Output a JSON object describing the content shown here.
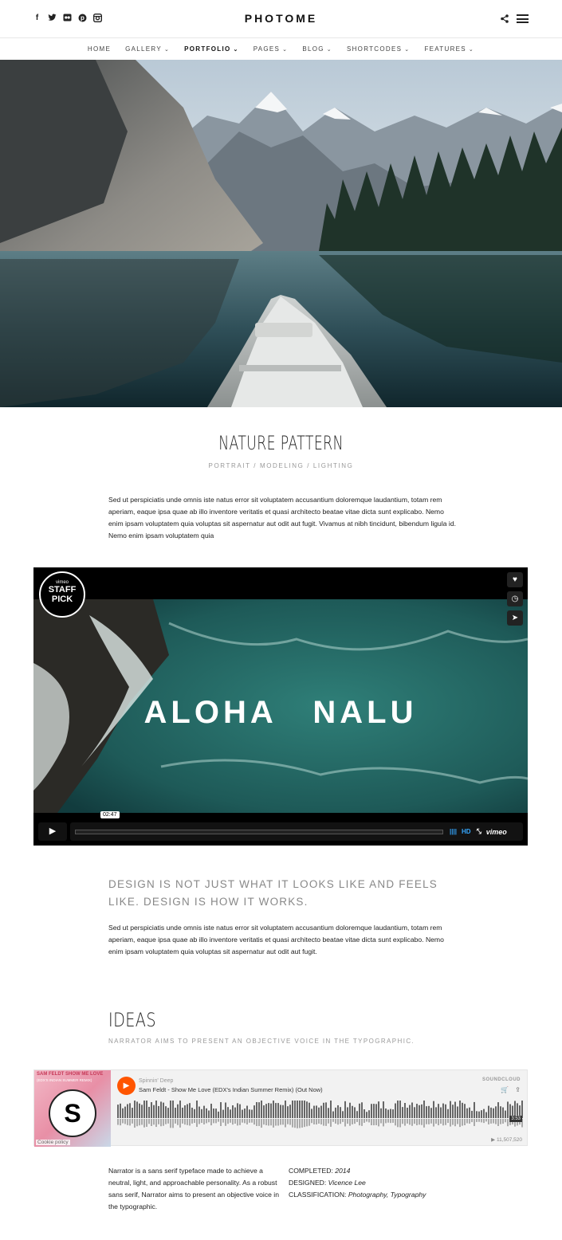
{
  "header": {
    "logo": "PHOTOME",
    "social_icons": [
      "facebook-icon",
      "twitter-icon",
      "flickr-icon",
      "pinterest-icon",
      "instagram-icon"
    ]
  },
  "nav": {
    "items": [
      {
        "label": "HOME",
        "dropdown": false,
        "active": false
      },
      {
        "label": "GALLERY",
        "dropdown": true,
        "active": false
      },
      {
        "label": "PORTFOLIO",
        "dropdown": true,
        "active": true
      },
      {
        "label": "PAGES",
        "dropdown": true,
        "active": false
      },
      {
        "label": "BLOG",
        "dropdown": true,
        "active": false
      },
      {
        "label": "SHORTCODES",
        "dropdown": true,
        "active": false
      },
      {
        "label": "FEATURES",
        "dropdown": true,
        "active": false
      }
    ]
  },
  "page": {
    "title": "NATURE PATTERN",
    "subtitle": "PORTRAIT / MODELING / LIGHTING",
    "intro": "Sed ut perspiciatis unde omnis iste natus error sit voluptatem accusantium doloremque laudantium, totam rem aperiam, eaque ipsa quae ab illo inventore veritatis et quasi architecto beatae vitae dicta sunt explicabo. Nemo enim ipsam voluptatem quia voluptas sit aspernatur aut odit aut fugit. Vivamus at nibh tincidunt, bibendum ligula id. Nemo enim ipsam voluptatem quia"
  },
  "video": {
    "title": "ALOHA NALU",
    "badge_top": "vimeo",
    "badge_line1": "STAFF",
    "badge_line2": "PICK",
    "time": "02:47",
    "hd_label": "HD",
    "brand": "vimeo",
    "progress": 0.0
  },
  "quote": {
    "text": "DESIGN IS NOT JUST WHAT IT LOOKS LIKE AND FEELS LIKE. DESIGN IS HOW IT WORKS.",
    "body": "Sed ut perspiciatis unde omnis iste natus error sit voluptatem accusantium doloremque laudantium, totam rem aperiam, eaque ipsa quae ab illo inventore veritatis et quasi architecto beatae vitae dicta sunt explicabo. Nemo enim ipsam voluptatem quia voluptas sit aspernatur aut odit aut fugit."
  },
  "ideas": {
    "title": "IDEAS",
    "subtitle": "NARRATOR AIMS TO PRESENT AN OBJECTIVE VOICE IN THE TYPOGRAPHIC."
  },
  "soundcloud": {
    "artist": "Spinnin' Deep",
    "track": "Sam Feldt - Show Me Love (EDX's Indian Summer Remix) (Out Now)",
    "brand": "SOUNDCLOUD",
    "art_title": "SAM FELDT  SHOW ME LOVE",
    "art_subtitle": "(EDX'S INDIAN SUMMER REMIX)",
    "duration": "3:53",
    "plays": "▶ 11,507,520",
    "cookie": "Cookie policy",
    "accent": "#ff5500"
  },
  "details": {
    "description": "Narrator is a sans serif typeface made to achieve a neutral, light, and approachable personality. As a robust sans serif, Narrator aims to present an objective voice in the typographic.",
    "completed_label": "COMPLETED:",
    "completed_value": "2014",
    "designed_label": "DESIGNED:",
    "designed_value": "Vicence Lee",
    "classification_label": "CLASSIFICATION:",
    "classification_value": "Photography, Typography"
  }
}
